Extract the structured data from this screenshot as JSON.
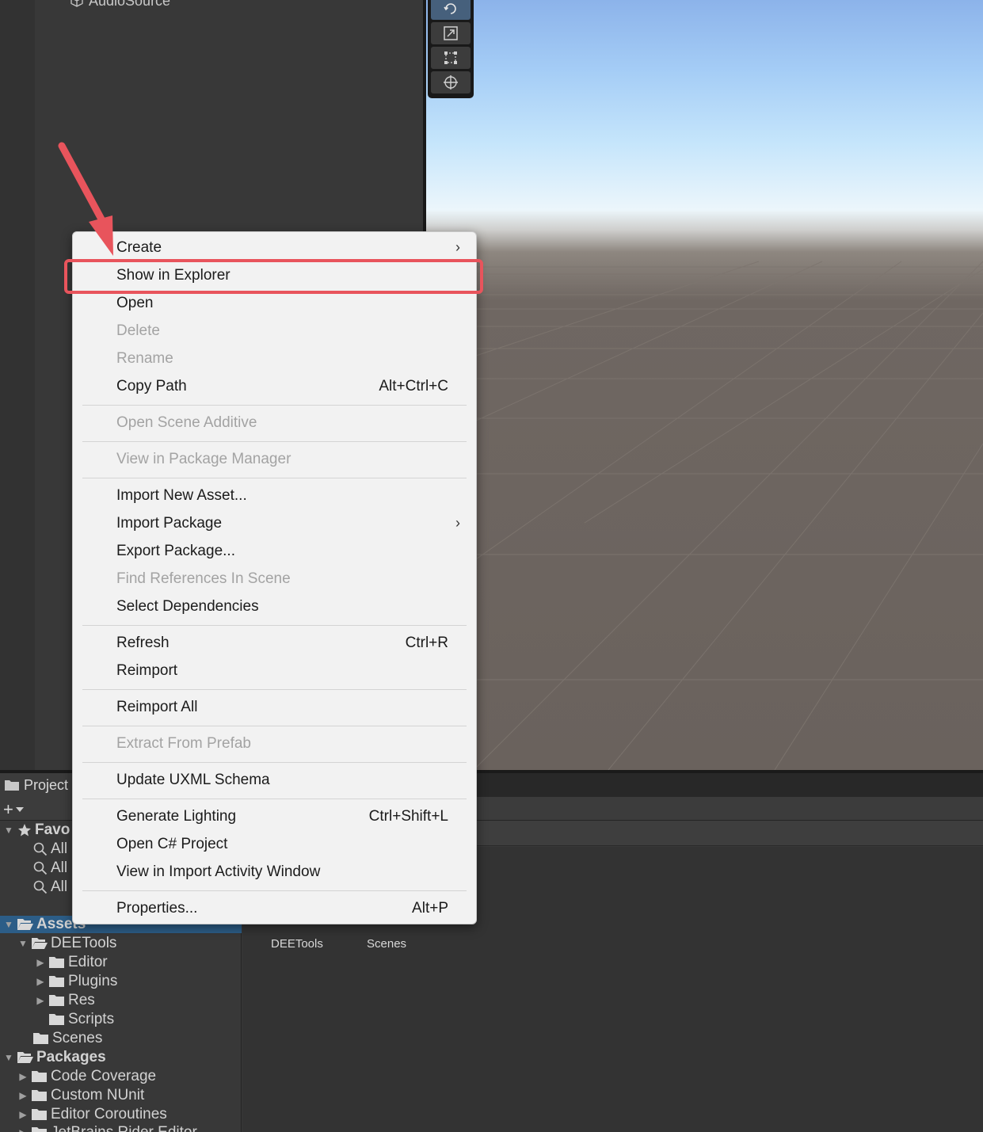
{
  "hierarchy": {
    "items": [
      {
        "label": "AudioSource"
      }
    ]
  },
  "scene": {
    "tools": [
      "rotate-tool",
      "scale-tool",
      "rect-tool",
      "transform-tool"
    ]
  },
  "project": {
    "tab_label": "Project",
    "add_label": "+",
    "tree": {
      "favorites": {
        "label": "Favo",
        "items": [
          "All",
          "All",
          "All"
        ]
      },
      "assets": {
        "label": "Assets"
      },
      "assets_children": [
        {
          "label": "DEETools"
        },
        {
          "label": "Editor"
        },
        {
          "label": "Plugins"
        },
        {
          "label": "Res"
        },
        {
          "label": "Scripts"
        },
        {
          "label": "Scenes"
        }
      ],
      "packages": {
        "label": "Packages"
      },
      "packages_children": [
        {
          "label": "Code Coverage"
        },
        {
          "label": "Custom NUnit"
        },
        {
          "label": "Editor Coroutines"
        },
        {
          "label": "JetBrains Rider Editor"
        }
      ]
    },
    "grid_items": [
      {
        "label": "DEETools"
      },
      {
        "label": "Scenes"
      }
    ]
  },
  "context_menu": {
    "items": [
      {
        "label": "Create",
        "submenu": true
      },
      {
        "label": "Show in Explorer",
        "highlighted": true
      },
      {
        "label": "Open"
      },
      {
        "label": "Delete",
        "disabled": true
      },
      {
        "label": "Rename",
        "disabled": true
      },
      {
        "label": "Copy Path",
        "shortcut": "Alt+Ctrl+C"
      },
      {
        "label": "Open Scene Additive",
        "disabled": true
      },
      {
        "label": "View in Package Manager",
        "disabled": true
      },
      {
        "label": "Import New Asset..."
      },
      {
        "label": "Import Package",
        "submenu": true
      },
      {
        "label": "Export Package..."
      },
      {
        "label": "Find References In Scene",
        "disabled": true
      },
      {
        "label": "Select Dependencies"
      },
      {
        "label": "Refresh",
        "shortcut": "Ctrl+R"
      },
      {
        "label": "Reimport"
      },
      {
        "label": "Reimport All"
      },
      {
        "label": "Extract From Prefab",
        "disabled": true
      },
      {
        "label": "Update UXML Schema"
      },
      {
        "label": "Generate Lighting",
        "shortcut": "Ctrl+Shift+L"
      },
      {
        "label": "Open C# Project"
      },
      {
        "label": "View in Import Activity Window"
      },
      {
        "label": "Properties...",
        "shortcut": "Alt+P"
      }
    ],
    "submenu_glyph": "›"
  },
  "annotation": {
    "highlight_color": "#e8545c"
  }
}
